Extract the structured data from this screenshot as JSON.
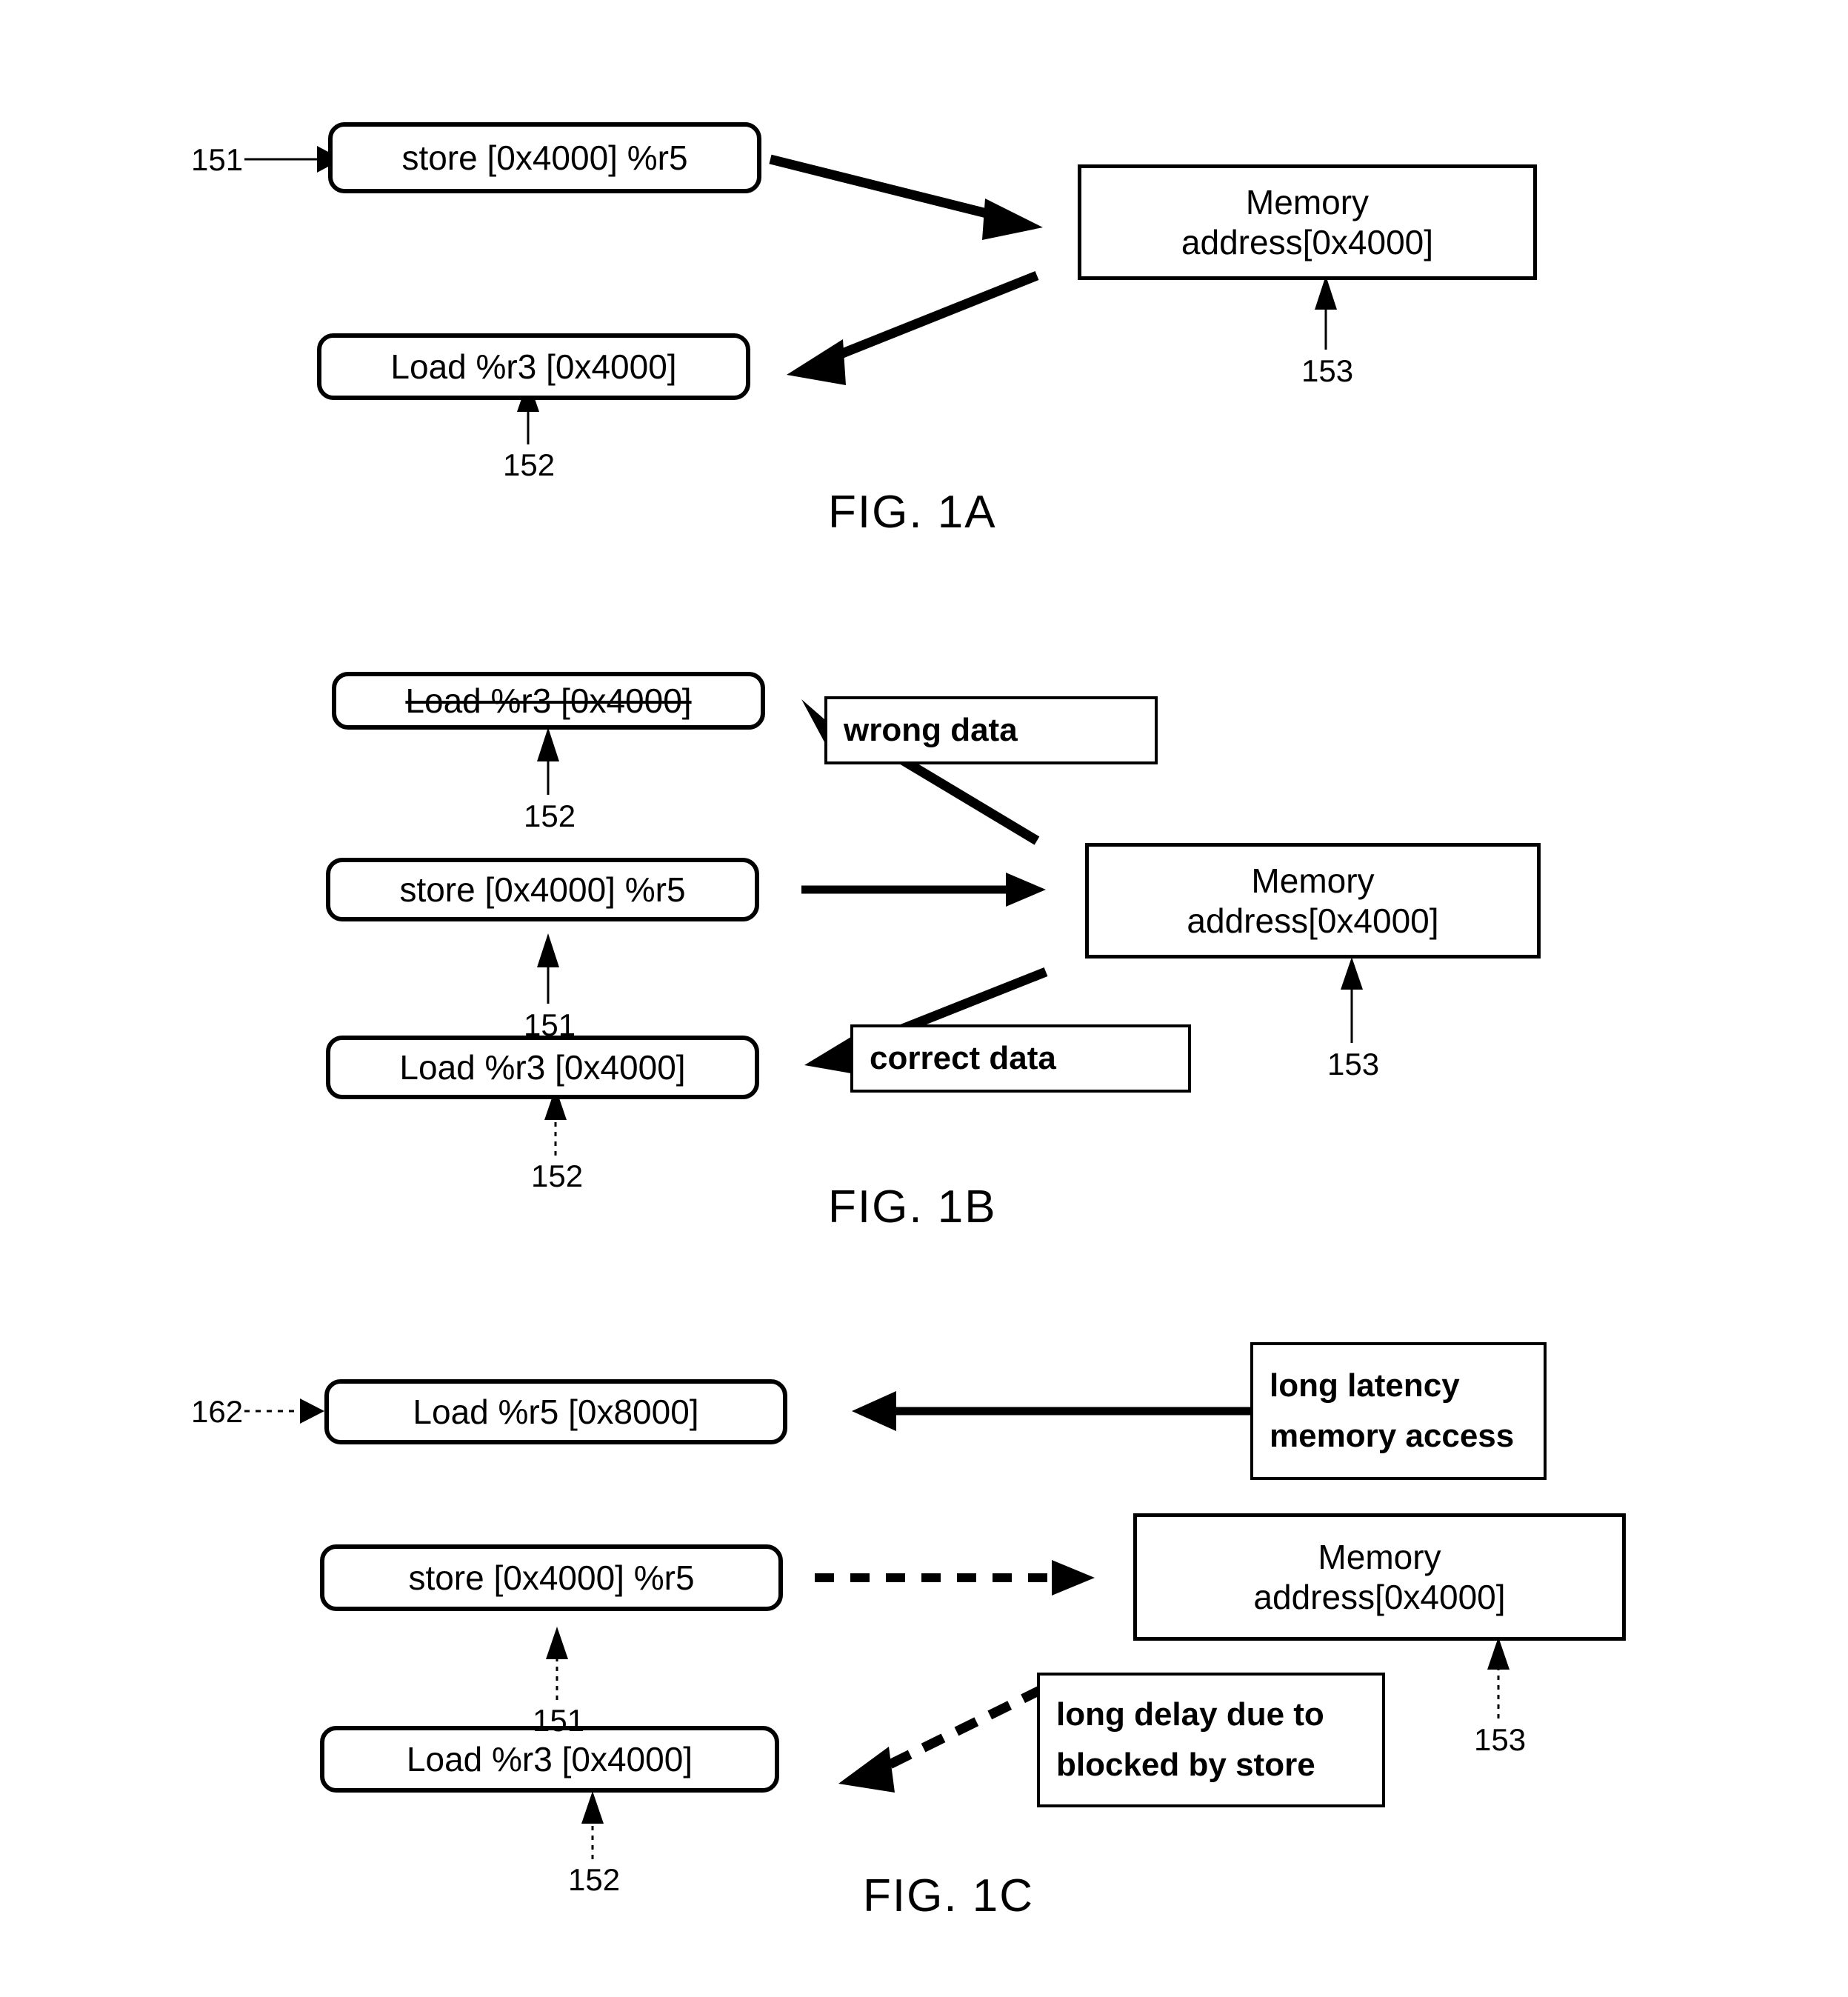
{
  "figures": [
    {
      "id": "fig-1a",
      "caption": "FIG. 1A",
      "nodes": {
        "store": "store [0x4000] %r5",
        "load": "Load %r3 [0x4000]",
        "memory_line1": "Memory",
        "memory_line2": "address[0x4000]"
      },
      "refs": {
        "store_ref": "151",
        "load_ref": "152",
        "memory_ref": "153"
      }
    },
    {
      "id": "fig-1b",
      "caption": "FIG. 1B",
      "nodes": {
        "load_cancelled": "Load %r3 [0x4000]",
        "store": "store [0x4000] %r5",
        "load": "Load %r3 [0x4000]",
        "memory_line1": "Memory",
        "memory_line2": "address[0x4000]",
        "wrong_data": "wrong data",
        "correct_data": "correct data"
      },
      "refs": {
        "load_cancelled_ref": "152",
        "store_ref": "151",
        "load_ref": "152",
        "memory_ref": "153"
      }
    },
    {
      "id": "fig-1c",
      "caption": "FIG. 1C",
      "nodes": {
        "load_r5": "Load %r5 [0x8000]",
        "store": "store [0x4000] %r5",
        "load_r3": "Load %r3 [0x4000]",
        "memory_line1": "Memory",
        "memory_line2": "address[0x4000]",
        "latency_line1": "long latency",
        "latency_line2": "memory access",
        "delay_line1": "long delay due to",
        "delay_line2": "blocked by store"
      },
      "refs": {
        "load_r5_ref": "162",
        "store_ref": "151",
        "load_r3_ref": "152",
        "memory_ref": "153"
      }
    }
  ],
  "colors": {
    "ink": "#000000",
    "paper": "#ffffff"
  }
}
